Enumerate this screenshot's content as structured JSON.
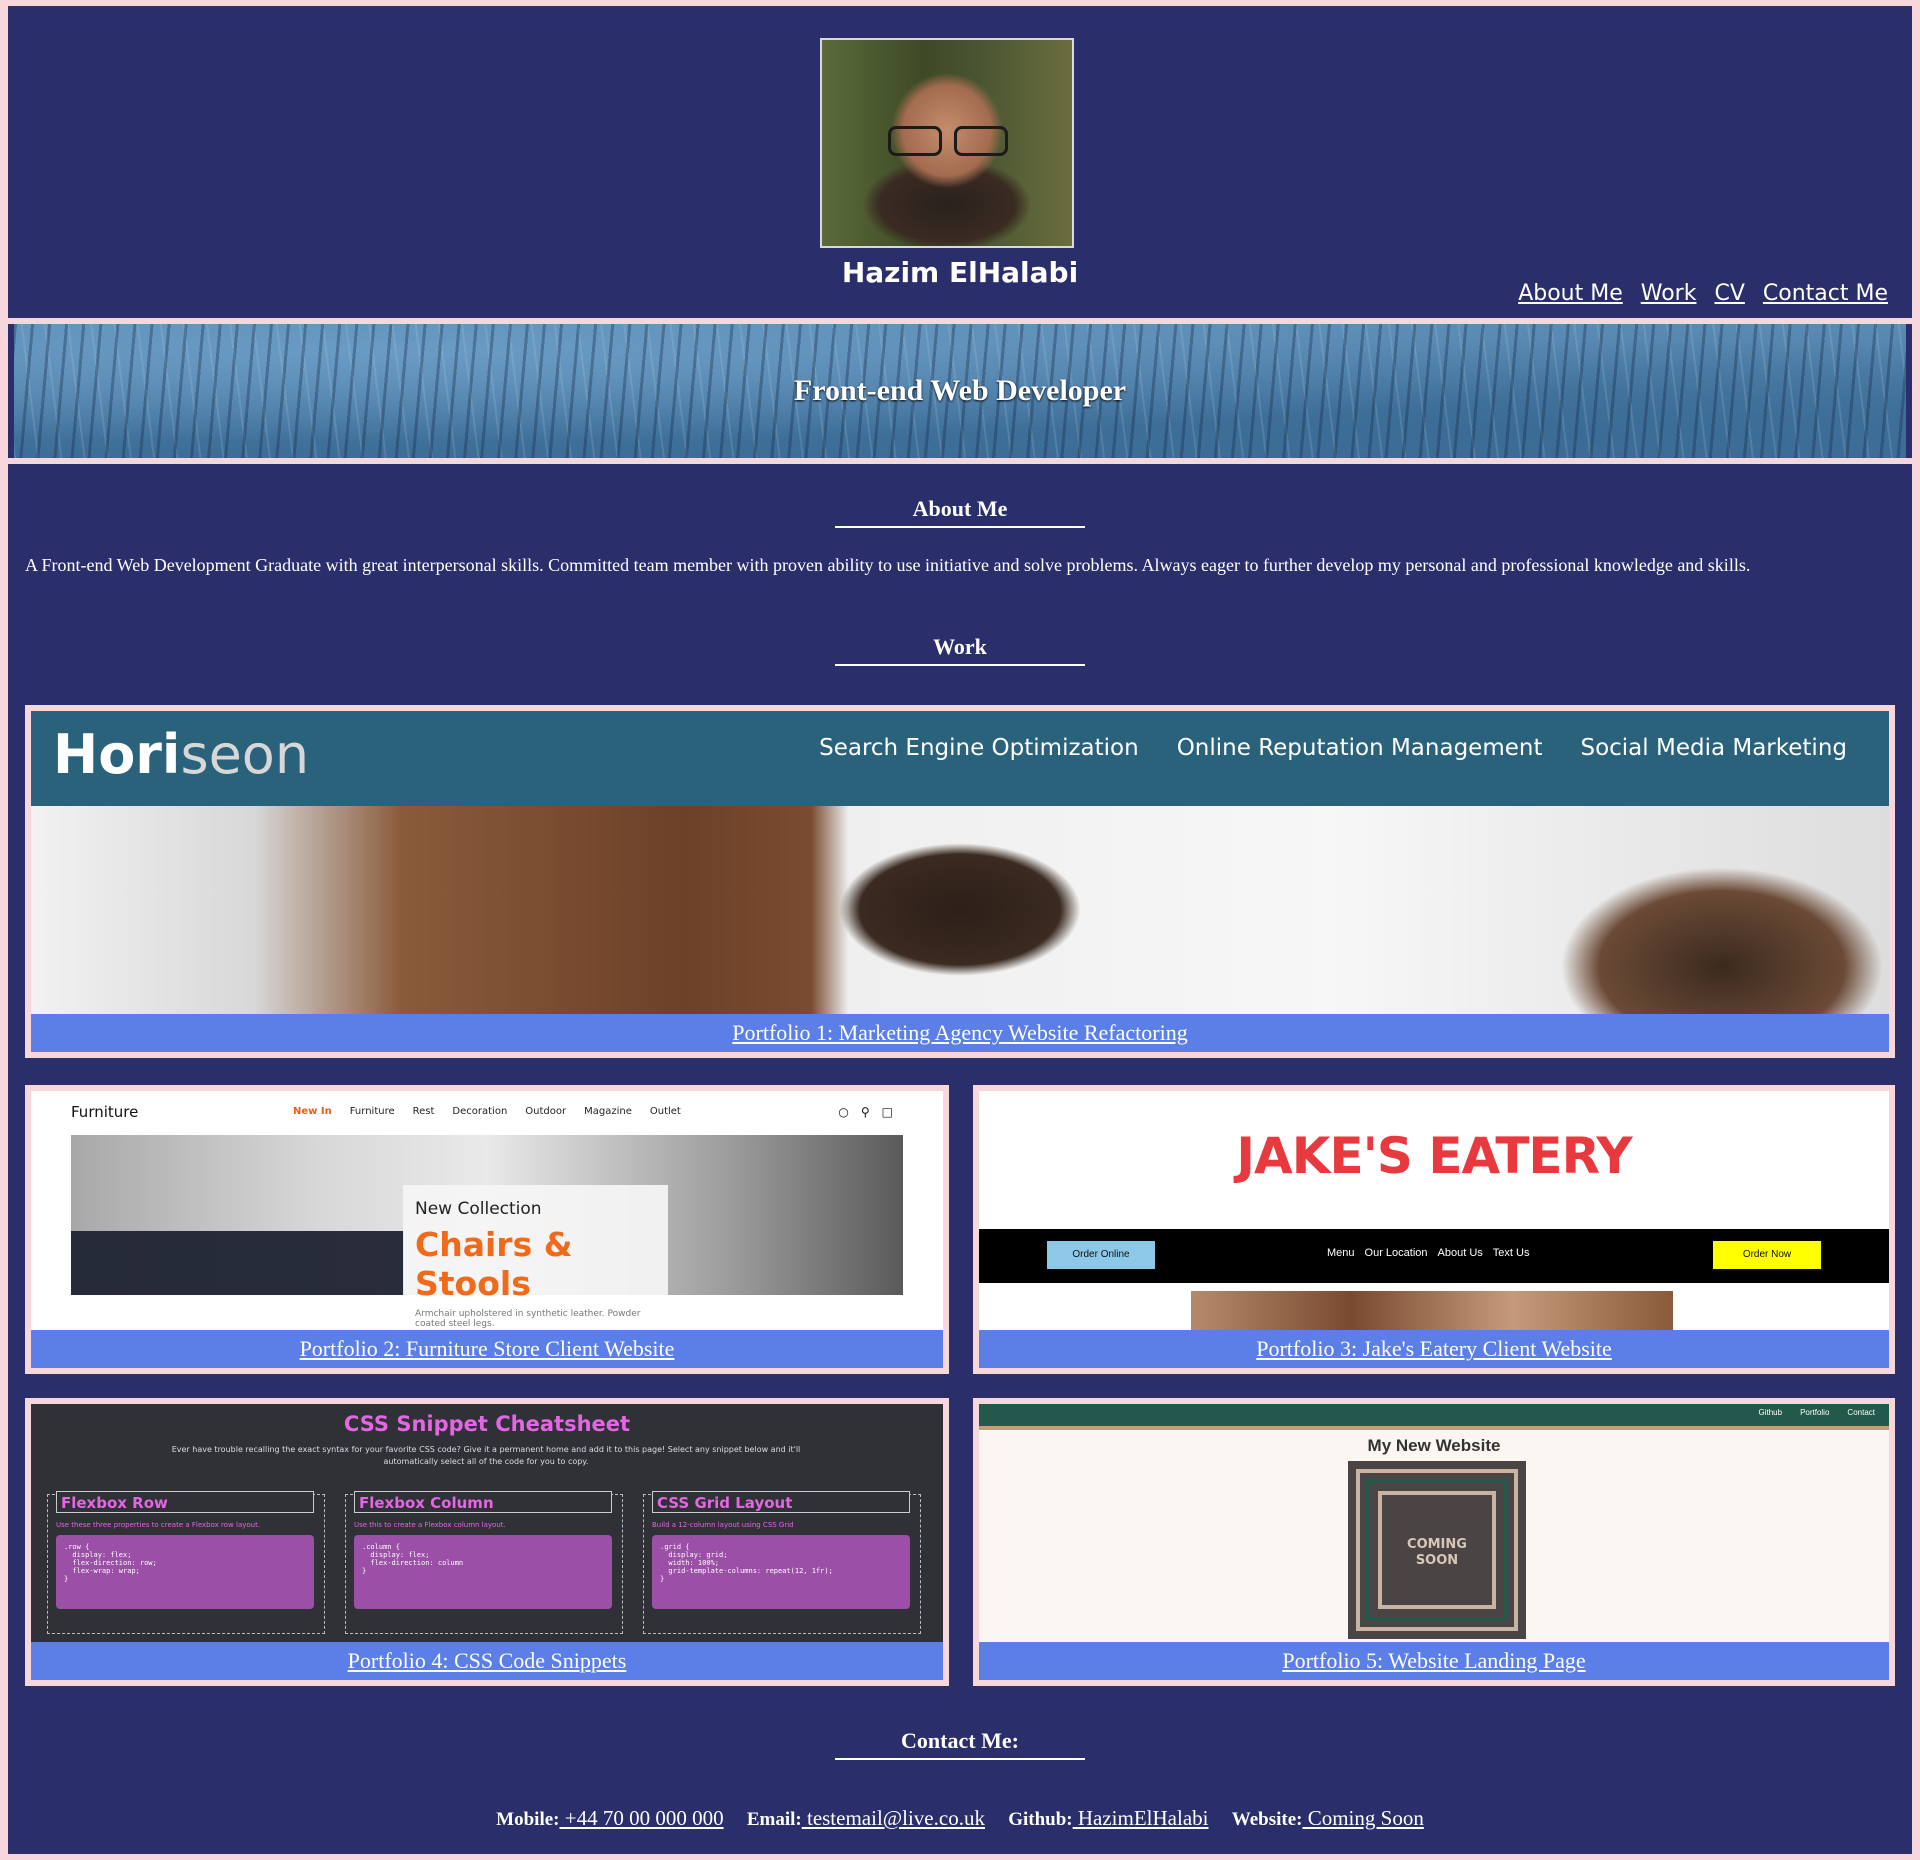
{
  "header": {
    "name": "Hazim ElHalabi",
    "nav": [
      "About Me",
      "Work",
      "CV",
      "Contact Me"
    ]
  },
  "banner": {
    "title": "Front-end Web Developer"
  },
  "about": {
    "heading": "About Me",
    "text": "A Front-end Web Development Graduate with great interpersonal skills. Committed team member with proven ability to use initiative and solve problems. Always eager to further develop my personal and professional knowledge and skills."
  },
  "work": {
    "heading": "Work",
    "portfolio1": {
      "caption": "Portfolio 1: Marketing Agency Website Refactoring",
      "logo_a": "Hori",
      "logo_b": "seon",
      "nav": [
        "Search Engine Optimization",
        "Online Reputation Management",
        "Social Media Marketing"
      ]
    },
    "portfolio2": {
      "caption": "Portfolio 2: Furniture Store Client Website",
      "brand": "Furniture",
      "nav": [
        "New In",
        "Furniture",
        "Rest",
        "Decoration",
        "Outdoor",
        "Magazine",
        "Outlet"
      ],
      "hero_small": "New Collection",
      "hero_big": "Chairs & Stools",
      "hero_desc": "Armchair upholstered in synthetic leather. Powder coated steel legs."
    },
    "portfolio3": {
      "caption": "Portfolio 3: Jake's Eatery Client Website",
      "title": "JAKE'S EATERY",
      "order_online": "Order Online",
      "nav": [
        "Menu",
        "Our Location",
        "About Us",
        "Text Us"
      ],
      "order_now": "Order Now"
    },
    "portfolio4": {
      "caption": "Portfolio 4: CSS Code Snippets",
      "title": "CSS Snippet Cheatsheet",
      "subtitle": "Ever have trouble recalling the exact syntax for your favorite CSS code? Give it a permanent home and add it to this page! Select any snippet below and it'll automatically select all of the code for you to copy.",
      "snippets": [
        {
          "title": "Flexbox Row",
          "desc": "Use these three properties to create a Flexbox row layout.",
          "code": ".row {\n  display: flex;\n  flex-direction: row;\n  flex-wrap: wrap;\n}"
        },
        {
          "title": "Flexbox Column",
          "desc": "Use this to create a Flexbox column layout.",
          "code": ".column {\n  display: flex;\n  flex-direction: column\n}"
        },
        {
          "title": "CSS Grid Layout",
          "desc": "Build a 12-column layout using CSS Grid",
          "code": ".grid {\n  display: grid;\n  width: 100%;\n  grid-template-columns: repeat(12, 1fr);\n}"
        }
      ]
    },
    "portfolio5": {
      "caption": "Portfolio 5: Website Landing Page",
      "nav": [
        "Github",
        "Portfolio",
        "Contact"
      ],
      "title": "My New Website",
      "badge_line1": "COMING",
      "badge_line2": "SOON"
    }
  },
  "contact": {
    "heading": "Contact Me:",
    "mobile_label": "Mobile:",
    "mobile": " +44 70 00 000 000",
    "email_label": "Email:",
    "email": " testemail@live.co.uk",
    "github_label": "Github:",
    "github": " HazimElHalabi",
    "website_label": "Website:",
    "website": " Coming Soon"
  }
}
